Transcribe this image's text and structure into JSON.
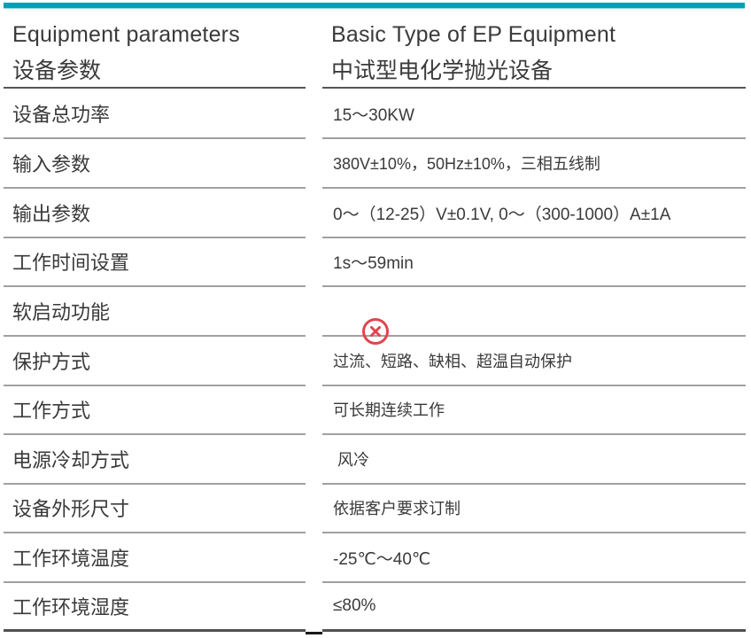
{
  "accent_color": "#00a0b7",
  "header": {
    "left_en": "Equipment parameters",
    "left_zh": "设备参数",
    "right_en": "Basic Type of EP Equipment",
    "right_zh": "中试型电化学抛光设备"
  },
  "rows": [
    {
      "param": "设备总功率",
      "value": "15～30KW"
    },
    {
      "param": "输入参数",
      "value": "380V±10%，50Hz±10%，三相五线制"
    },
    {
      "param": "输出参数",
      "value": "0～（12-25）V±0.1V, 0～（300-1000）A±1A"
    },
    {
      "param": "工作时间设置",
      "value": "1s～59min"
    },
    {
      "param": "软启动功能",
      "value": null,
      "icon": "x-circle-icon",
      "icon_color": "#e0454f"
    },
    {
      "param": "保护方式",
      "value": "过流、短路、缺相、超温自动保护"
    },
    {
      "param": "工作方式",
      "value": "可长期连续工作"
    },
    {
      "param": "电源冷却方式",
      "value": " 风冷"
    },
    {
      "param": "设备外形尺寸",
      "value": "依据客户要求订制"
    },
    {
      "param": "工作环境温度",
      "value": "-25℃～40℃"
    },
    {
      "param": "工作环境湿度",
      "value": "≤80%"
    }
  ]
}
